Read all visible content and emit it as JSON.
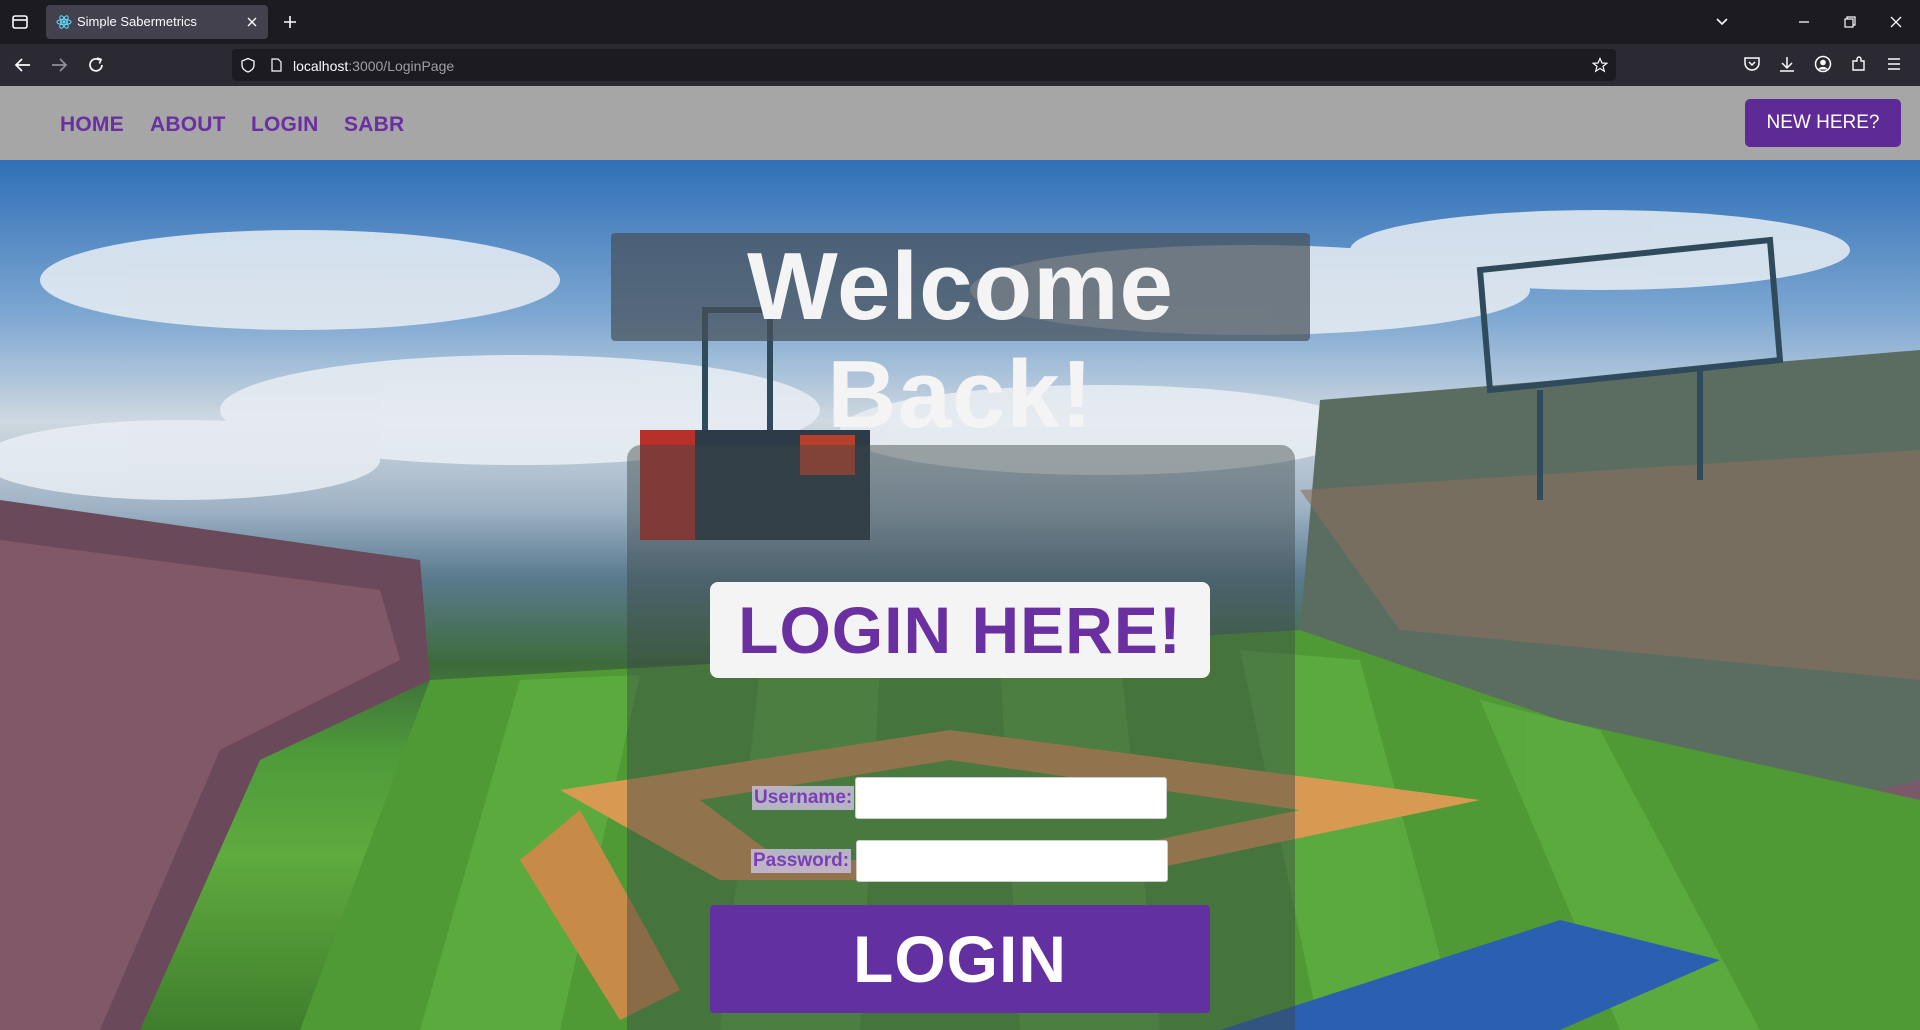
{
  "browser": {
    "tab_title": "Simple Sabermetrics",
    "url_host": "localhost",
    "url_rest": ":3000/LoginPage"
  },
  "site": {
    "nav": [
      "HOME",
      "ABOUT",
      "LOGIN",
      "SABR"
    ],
    "new_here": "NEW HERE?"
  },
  "hero": {
    "welcome": "Welcome Back!",
    "login_here": "LOGIN HERE!",
    "username_label": "Username:",
    "password_label": "Password:",
    "username_value": "",
    "password_value": "",
    "login_button": "LOGIN"
  },
  "colors": {
    "accent": "#6a2fa0",
    "button": "#6330a1",
    "nav_bg": "#a6a6a6"
  }
}
